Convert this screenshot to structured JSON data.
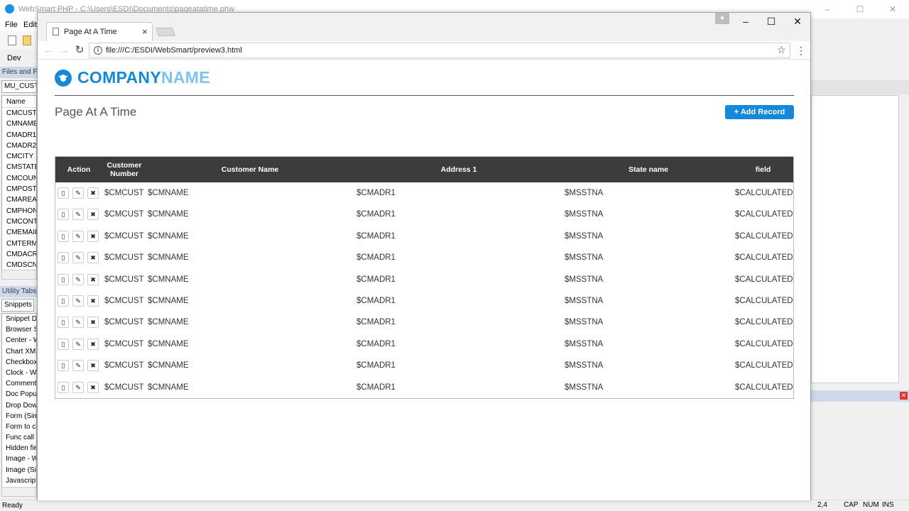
{
  "ide": {
    "title": "WebSmart PHP - C:\\Users\\ESDI\\Documents\\pageatatime.phw",
    "menu": [
      "File",
      "Edit"
    ],
    "dev_label": "Dev",
    "files_header": "Files and Fu",
    "files_combo": "MU_CUSTF",
    "files_col_header": "Name",
    "fields": [
      "CMCUST",
      "CMNAME",
      "CMADR1",
      "CMADR2",
      "CMCITY",
      "CMSTATE",
      "CMCOUN",
      "CMPOST",
      "CMAREA",
      "CMPHON",
      "CMCONT",
      "CMEMAIL",
      "CMTERM",
      "CMDACR",
      "CMDSCNT"
    ],
    "utility_header": "Utility Tabs",
    "snippets_tab": "Snippets",
    "snippets": [
      "Snippet De",
      "Browser Sn",
      "Center - W",
      "Chart XML",
      "Checkbox",
      "Clock - WS",
      "Comment",
      "Doc Popup",
      "Drop Dow",
      "Form (Sim",
      "Form to ca",
      "Func call -",
      "Hidden fie",
      "Image - W",
      "Image (Sin",
      "Javascript"
    ],
    "status": {
      "ready": "Ready",
      "position": "2,4",
      "cap": "CAP",
      "num": "NUM",
      "ins": "INS"
    }
  },
  "browser": {
    "tab_title": "Page At A Time",
    "tab_close": "×",
    "url": "file:///C:/ESDI/WebSmart/preview3.html",
    "win_controls": {
      "minimize": "–",
      "maximize": "☐",
      "close": "✕"
    },
    "nav": {
      "back": "←",
      "forward": "→",
      "reload": "↻"
    }
  },
  "page": {
    "company_part1": "COMPANY",
    "company_part2": "NAME",
    "title": "Page At A Time",
    "add_button": "+ Add Record",
    "headers": {
      "action": "Action",
      "customer_number_1": "Customer",
      "customer_number_2": "Number",
      "customer_name": "Customer Name",
      "address1": "Address 1",
      "state": "State name",
      "field": "field"
    },
    "rows": [
      {
        "cust": "$CMCUST",
        "name": "$CMNAME",
        "addr": "$CMADR1",
        "state": "$MSSTNA",
        "calc": "$CALCULATED"
      },
      {
        "cust": "$CMCUST",
        "name": "$CMNAME",
        "addr": "$CMADR1",
        "state": "$MSSTNA",
        "calc": "$CALCULATED"
      },
      {
        "cust": "$CMCUST",
        "name": "$CMNAME",
        "addr": "$CMADR1",
        "state": "$MSSTNA",
        "calc": "$CALCULATED"
      },
      {
        "cust": "$CMCUST",
        "name": "$CMNAME",
        "addr": "$CMADR1",
        "state": "$MSSTNA",
        "calc": "$CALCULATED"
      },
      {
        "cust": "$CMCUST",
        "name": "$CMNAME",
        "addr": "$CMADR1",
        "state": "$MSSTNA",
        "calc": "$CALCULATED"
      },
      {
        "cust": "$CMCUST",
        "name": "$CMNAME",
        "addr": "$CMADR1",
        "state": "$MSSTNA",
        "calc": "$CALCULATED"
      },
      {
        "cust": "$CMCUST",
        "name": "$CMNAME",
        "addr": "$CMADR1",
        "state": "$MSSTNA",
        "calc": "$CALCULATED"
      },
      {
        "cust": "$CMCUST",
        "name": "$CMNAME",
        "addr": "$CMADR1",
        "state": "$MSSTNA",
        "calc": "$CALCULATED"
      },
      {
        "cust": "$CMCUST",
        "name": "$CMNAME",
        "addr": "$CMADR1",
        "state": "$MSSTNA",
        "calc": "$CALCULATED"
      },
      {
        "cust": "$CMCUST",
        "name": "$CMNAME",
        "addr": "$CMADR1",
        "state": "$MSSTNA",
        "calc": "$CALCULATED"
      }
    ],
    "row_icons": {
      "view": "▯",
      "edit": "✎",
      "delete": "✖"
    }
  }
}
